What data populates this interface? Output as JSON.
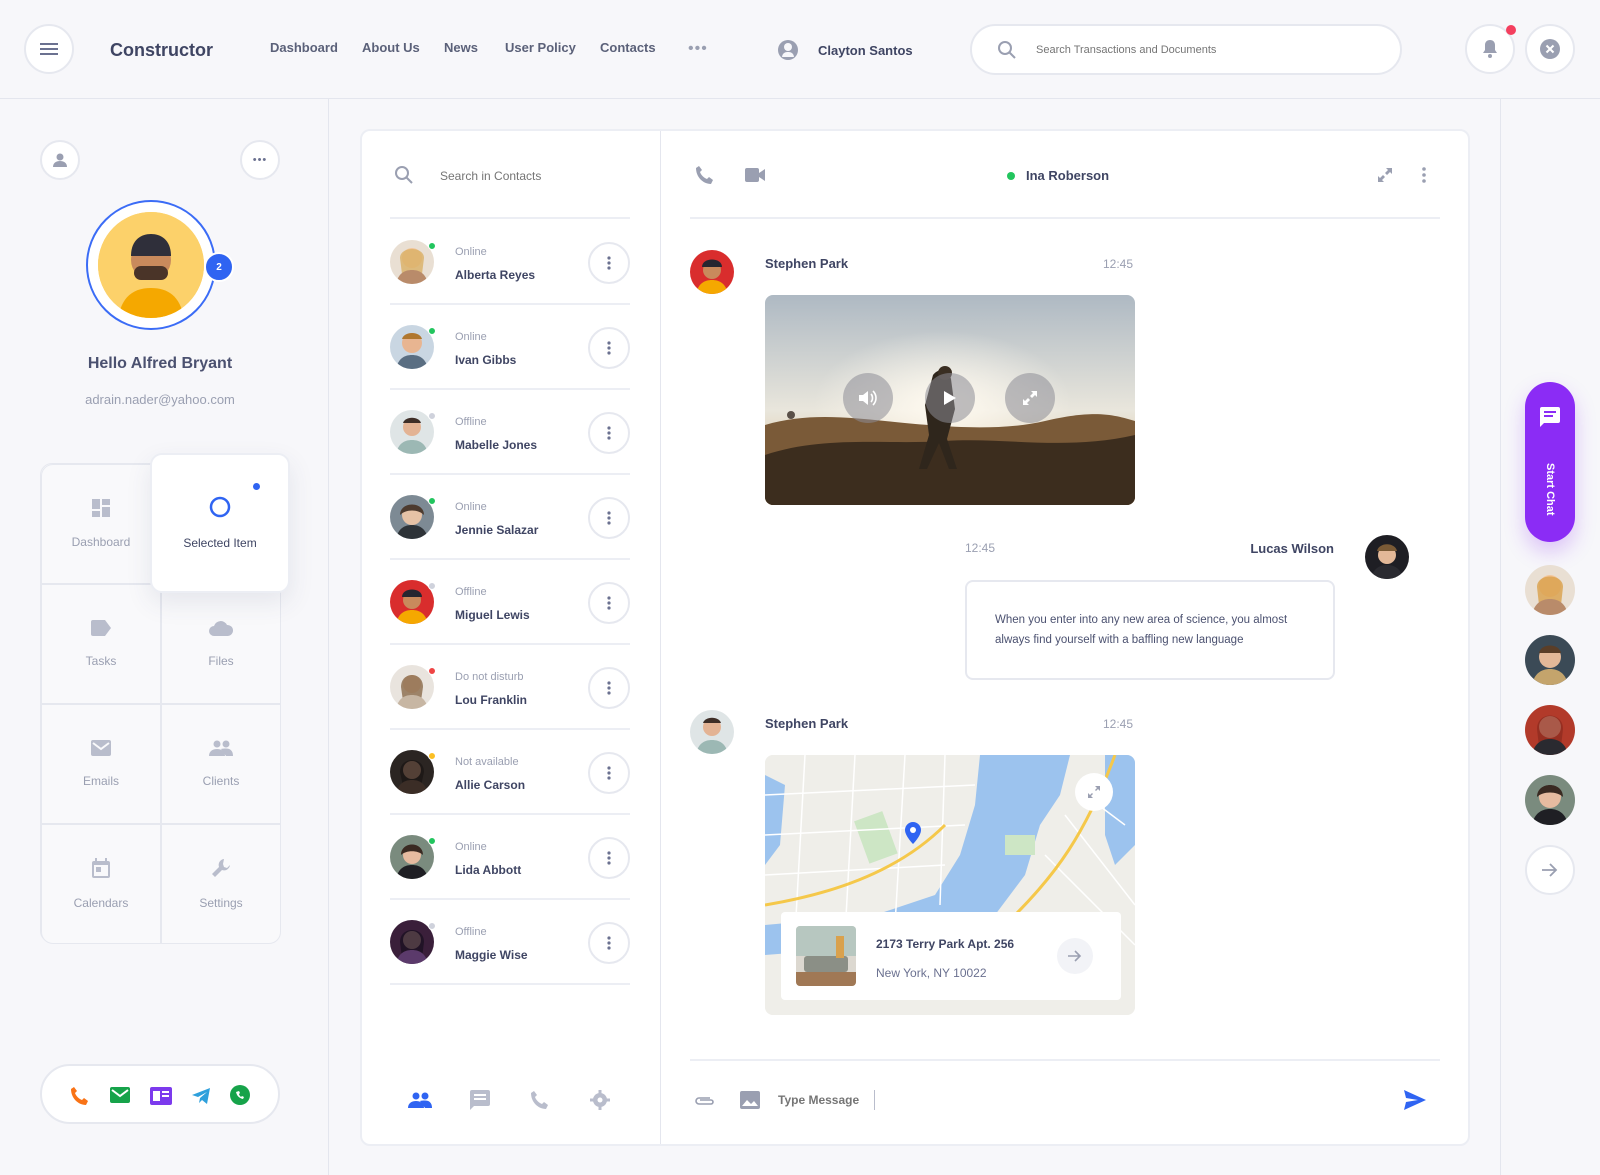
{
  "header": {
    "brand": "Constructor",
    "nav": [
      "Dashboard",
      "About Us",
      "News",
      "User Policy",
      "Contacts"
    ],
    "user_name": "Clayton Santos",
    "search_placeholder": "Search Transactions and Documents"
  },
  "profile": {
    "badge": "2",
    "greeting": "Hello Alfred Bryant",
    "email": "adrain.nader@yahoo.com"
  },
  "menu": [
    {
      "label": "Dashboard",
      "icon": "dashboard-icon"
    },
    {
      "label": "Selected Item",
      "icon": "circle-icon"
    },
    {
      "label": "Tasks",
      "icon": "label-icon"
    },
    {
      "label": "Files",
      "icon": "cloud-icon"
    },
    {
      "label": "Emails",
      "icon": "mail-icon"
    },
    {
      "label": "Clients",
      "icon": "people-icon"
    },
    {
      "label": "Calendars",
      "icon": "calendar-icon"
    },
    {
      "label": "Settings",
      "icon": "wrench-icon"
    }
  ],
  "contacts": {
    "search_placeholder": "Search in Contacts",
    "items": [
      {
        "status": "Online",
        "name": "Alberta Reyes",
        "color": "#22c55e"
      },
      {
        "status": "Online",
        "name": "Ivan Gibbs",
        "color": "#22c55e"
      },
      {
        "status": "Offline",
        "name": "Mabelle Jones",
        "color": "#cfd2dc"
      },
      {
        "status": "Online",
        "name": "Jennie Salazar",
        "color": "#22c55e"
      },
      {
        "status": "Offline",
        "name": "Miguel Lewis",
        "color": "#cfd2dc"
      },
      {
        "status": "Do not disturb",
        "name": "Lou Franklin",
        "color": "#ef4444"
      },
      {
        "status": "Not available",
        "name": "Allie Carson",
        "color": "#fbbf24"
      },
      {
        "status": "Online",
        "name": "Lida Abbott",
        "color": "#22c55e"
      },
      {
        "status": "Offline",
        "name": "Maggie Wise",
        "color": "#cfd2dc"
      }
    ]
  },
  "chat": {
    "partner": "Ina Roberson",
    "messages": [
      {
        "sender": "Stephen Park",
        "time": "12:45"
      },
      {
        "sender": "Lucas Wilson",
        "time": "12:45",
        "text": "When you enter into any new area of science, you almost always find yourself with a baffling new language"
      },
      {
        "sender": "Stephen Park",
        "time": "12:45"
      }
    ],
    "address_line1": "2173 Terry Park Apt. 256",
    "address_line2": "New York, NY 10022",
    "input_placeholder": "Type Message"
  },
  "right": {
    "start_chat": "Start Chat"
  }
}
